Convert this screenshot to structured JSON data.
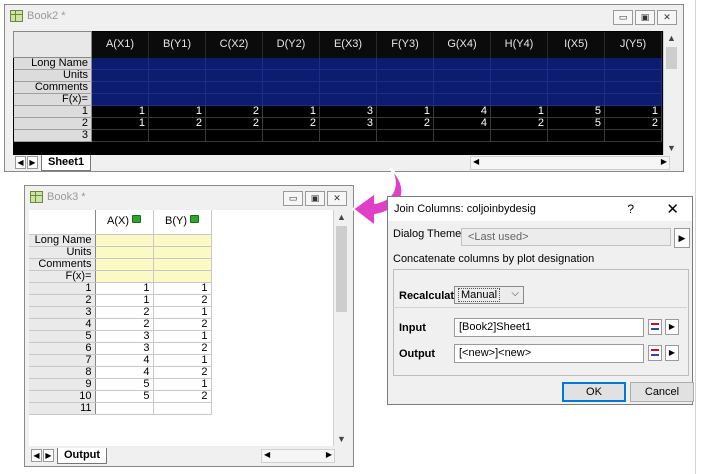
{
  "book2": {
    "title": "Book2 *",
    "columns": [
      "A(X1)",
      "B(Y1)",
      "C(X2)",
      "D(Y2)",
      "E(X3)",
      "F(Y3)",
      "G(X4)",
      "H(Y4)",
      "I(X5)",
      "J(Y5)"
    ],
    "meta_labels": [
      "Long Name",
      "Units",
      "Comments",
      "F(x)="
    ],
    "rows": [
      {
        "label": "1",
        "cells": [
          "1",
          "1",
          "2",
          "1",
          "3",
          "1",
          "4",
          "1",
          "5",
          "1"
        ]
      },
      {
        "label": "2",
        "cells": [
          "1",
          "2",
          "2",
          "2",
          "3",
          "2",
          "4",
          "2",
          "5",
          "2"
        ]
      },
      {
        "label": "3",
        "cells": [
          "",
          "",
          "",
          "",
          "",
          "",
          "",
          "",
          "",
          ""
        ]
      }
    ],
    "sheet_tab": "Sheet1"
  },
  "book3": {
    "title": "Book3 *",
    "columns": [
      "A(X)",
      "B(Y)"
    ],
    "meta_labels": [
      "Long Name",
      "Units",
      "Comments",
      "F(x)="
    ],
    "rows": [
      {
        "label": "1",
        "cells": [
          "1",
          "1"
        ]
      },
      {
        "label": "2",
        "cells": [
          "1",
          "2"
        ]
      },
      {
        "label": "3",
        "cells": [
          "2",
          "1"
        ]
      },
      {
        "label": "4",
        "cells": [
          "2",
          "2"
        ]
      },
      {
        "label": "5",
        "cells": [
          "3",
          "1"
        ]
      },
      {
        "label": "6",
        "cells": [
          "3",
          "2"
        ]
      },
      {
        "label": "7",
        "cells": [
          "4",
          "1"
        ]
      },
      {
        "label": "8",
        "cells": [
          "4",
          "2"
        ]
      },
      {
        "label": "9",
        "cells": [
          "5",
          "1"
        ]
      },
      {
        "label": "10",
        "cells": [
          "5",
          "2"
        ]
      },
      {
        "label": "11",
        "cells": [
          "",
          ""
        ]
      }
    ],
    "sheet_tab": "Output"
  },
  "dialog": {
    "title": "Join Columns: coljoinbydesig",
    "help": "?",
    "close": "✕",
    "theme_label": "Dialog Theme",
    "theme_value": "<Last used>",
    "description": "Concatenate columns by plot designation",
    "recalculate_label": "Recalculate",
    "recalculate_value": "Manual",
    "input_label": "Input",
    "input_value": "[Book2]Sheet1",
    "output_label": "Output",
    "output_value": "[<new>]<new>",
    "ok": "OK",
    "cancel": "Cancel"
  },
  "icons": {
    "window_min": "minimize-icon",
    "window_max": "maximize-icon",
    "window_close": "close-icon",
    "lock": "lock-icon",
    "arrow": "curved-arrow-icon"
  },
  "colors": {
    "arrow": "#e040c8",
    "meta_band_dark": "#0c1c6e",
    "meta_band_light": "#fbfac5",
    "lock": "#2ea52e"
  },
  "glyphs": {
    "min": "▭",
    "max": "▣",
    "close": "✕",
    "up": "▲",
    "down": "▼",
    "left": "◀",
    "right": "▶",
    "chevron": "⌵"
  }
}
